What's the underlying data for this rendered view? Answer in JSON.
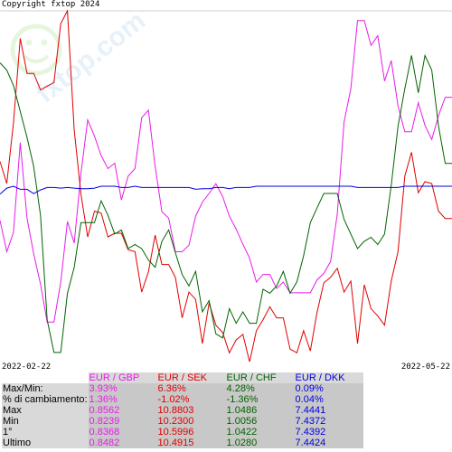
{
  "copyright": "Copyright fxtop 2024",
  "watermark": "fxtop.com",
  "date_start": "2022-02-22",
  "date_end": "2022-05-22",
  "colors": {
    "EUR / GBP": "#e81be8",
    "EUR / SEK": "#e00000",
    "EUR / CHF": "#006400",
    "EUR / DKK": "#0000e0"
  },
  "table": {
    "headers": [
      "EUR / GBP",
      "EUR / SEK",
      "EUR / CHF",
      "EUR / DKK"
    ],
    "rows": [
      {
        "label": "Max/Min:",
        "values": [
          "3.93%",
          "6.36%",
          "4.28%",
          "0.09%"
        ]
      },
      {
        "label": "% di cambiamento:",
        "values": [
          "1.36%",
          "-1.02%",
          "-1.36%",
          "0.04%"
        ]
      },
      {
        "label": "Max",
        "values": [
          "0.8562",
          "10.8803",
          "1.0486",
          "7.4441"
        ]
      },
      {
        "label": "Min",
        "values": [
          "0.8239",
          "10.2300",
          "1.0056",
          "7.4372"
        ]
      },
      {
        "label": "1°",
        "values": [
          "0.8368",
          "10.5996",
          "1.0422",
          "7.4392"
        ]
      },
      {
        "label": "Ultimo",
        "values": [
          "0.8482",
          "10.4915",
          "1.0280",
          "7.4424"
        ]
      }
    ]
  },
  "chart_data": {
    "type": "line",
    "x": [
      "2022-02-22",
      "2022-05-22"
    ],
    "series": [
      {
        "name": "EUR / GBP",
        "min": 0.8239,
        "max": 0.8562,
        "values": [
          0.8368,
          0.8339,
          0.8357,
          0.844,
          0.837,
          0.8337,
          0.8309,
          0.8274,
          0.8274,
          0.8311,
          0.8367,
          0.8347,
          0.8412,
          0.8461,
          0.8446,
          0.8428,
          0.8416,
          0.8421,
          0.8387,
          0.8409,
          0.8416,
          0.8463,
          0.847,
          0.8418,
          0.8376,
          0.837,
          0.8339,
          0.8339,
          0.8345,
          0.8372,
          0.8385,
          0.8393,
          0.8402,
          0.839,
          0.8372,
          0.836,
          0.8346,
          0.8333,
          0.8311,
          0.8318,
          0.8318,
          0.8305,
          0.8311,
          0.8301,
          0.8301,
          0.8301,
          0.8301,
          0.8313,
          0.8319,
          0.833,
          0.8374,
          0.8459,
          0.849,
          0.8553,
          0.8553,
          0.853,
          0.8539,
          0.8497,
          0.8516,
          0.8474,
          0.845,
          0.845,
          0.8477,
          0.8456,
          0.8443,
          0.8465,
          0.8482,
          0.8482
        ]
      },
      {
        "name": "EUR / SEK",
        "min": 10.23,
        "max": 10.8803,
        "values": [
          10.5996,
          10.5585,
          10.6716,
          10.8289,
          10.7638,
          10.7638,
          10.733,
          10.7399,
          10.7467,
          10.8563,
          10.8803,
          10.6579,
          10.5379,
          10.459,
          10.507,
          10.5036,
          10.459,
          10.4659,
          10.4659,
          10.435,
          10.4316,
          10.3562,
          10.3939,
          10.4624,
          10.4076,
          10.4076,
          10.3836,
          10.3082,
          10.3562,
          10.3425,
          10.2602,
          10.3356,
          10.2945,
          10.2807,
          10.243,
          10.267,
          10.2773,
          10.2259,
          10.2842,
          10.3048,
          10.3288,
          10.3082,
          10.3082,
          10.2499,
          10.243,
          10.2842,
          10.2465,
          10.3185,
          10.3733,
          10.3836,
          10.4007,
          10.3562,
          10.3767,
          10.2602,
          10.3699,
          10.3253,
          10.3116,
          10.2945,
          10.3767,
          10.4316,
          10.5722,
          10.6168,
          10.5413,
          10.5619,
          10.5585,
          10.507,
          10.4933,
          10.4933
        ]
      },
      {
        "name": "EUR / CHF",
        "min": 1.0056,
        "max": 1.0486,
        "values": [
          1.0422,
          1.0413,
          1.0394,
          1.0362,
          1.033,
          1.0294,
          1.0234,
          1.0105,
          1.0065,
          1.0065,
          1.0138,
          1.017,
          1.0225,
          1.0225,
          1.0225,
          1.0252,
          1.0234,
          1.0211,
          1.0216,
          1.0193,
          1.0198,
          1.0193,
          1.0179,
          1.017,
          1.0202,
          1.0216,
          1.0188,
          1.0161,
          1.0147,
          1.0165,
          1.0115,
          1.0129,
          1.0088,
          1.0083,
          1.0119,
          1.0101,
          1.0115,
          1.0101,
          1.0101,
          1.0143,
          1.0138,
          1.0147,
          1.0165,
          1.0138,
          1.0152,
          1.0184,
          1.0225,
          1.0243,
          1.0261,
          1.0261,
          1.0261,
          1.0229,
          1.0211,
          1.0193,
          1.0202,
          1.0207,
          1.0198,
          1.0211,
          1.0271,
          1.0344,
          1.039,
          1.0431,
          1.0385,
          1.0431,
          1.0413,
          1.0344,
          1.0298,
          1.0298
        ]
      },
      {
        "name": "EUR / DKK",
        "min": 7.4372,
        "max": 7.4441,
        "values": [
          7.4392,
          7.4402,
          7.4405,
          7.44,
          7.44,
          7.4393,
          7.4399,
          7.4403,
          7.4403,
          7.4402,
          7.4403,
          7.4402,
          7.4401,
          7.4401,
          7.4402,
          7.4405,
          7.4405,
          7.4405,
          7.4403,
          7.4403,
          7.4405,
          7.4403,
          7.4403,
          7.4403,
          7.4403,
          7.4403,
          7.4403,
          7.4403,
          7.4403,
          7.44,
          7.4401,
          7.4401,
          7.4403,
          7.4403,
          7.4401,
          7.4403,
          7.4403,
          7.4403,
          7.4405,
          7.4405,
          7.4405,
          7.4405,
          7.4405,
          7.4405,
          7.4405,
          7.4405,
          7.4405,
          7.4405,
          7.4405,
          7.4405,
          7.4405,
          7.4405,
          7.4405,
          7.4403,
          7.4403,
          7.4403,
          7.4403,
          7.4403,
          7.4403,
          7.4403,
          7.4405,
          7.4405,
          7.4405,
          7.4405,
          7.4405,
          7.4405,
          7.4405,
          7.4405
        ]
      }
    ],
    "grid": false,
    "legend": "table-below"
  }
}
